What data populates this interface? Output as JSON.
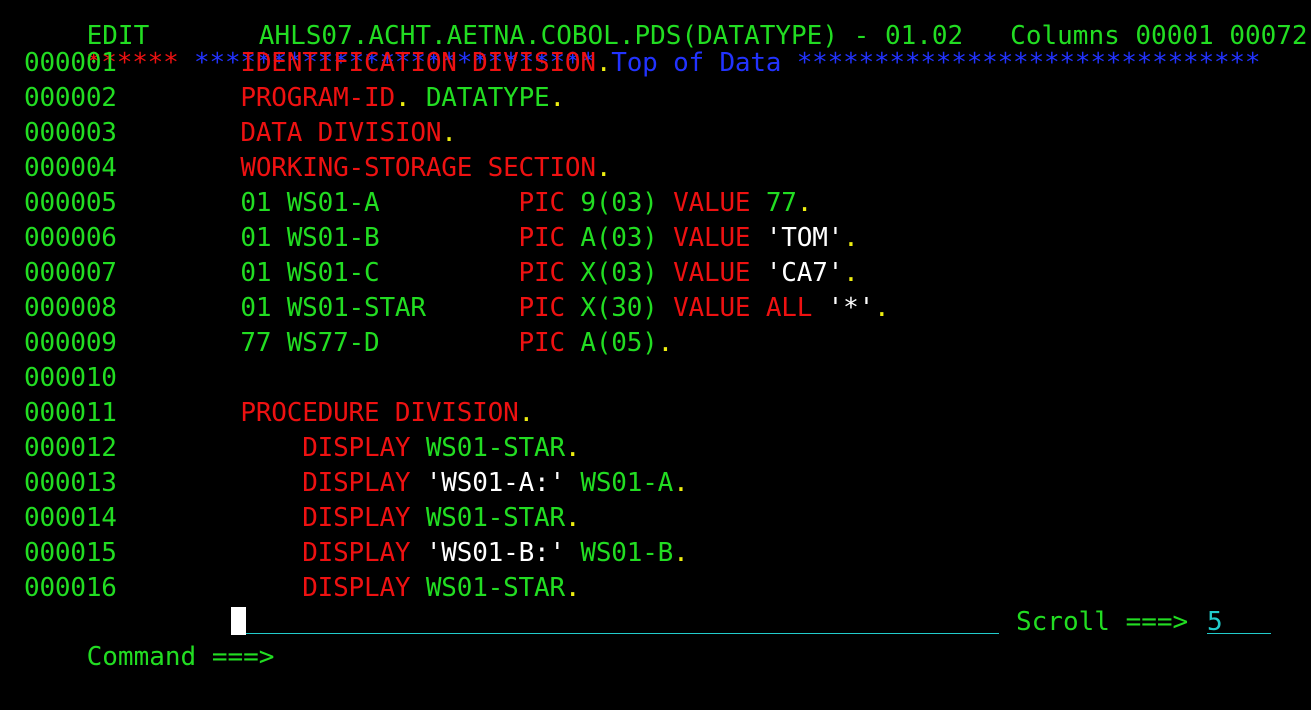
{
  "header": {
    "partial_line": "EDIT       AHLS07.ACHT.AETNA.COBOL.PDS(DATATYPE) - 01.02   Columns 00001 00072"
  },
  "top_of_data": {
    "left_stars": "******",
    "marker": "************************** Top of Data ******************************"
  },
  "lines": [
    {
      "num": "000001",
      "segs": [
        {
          "text": "        ",
          "c": "g"
        },
        {
          "text": "IDENTIFICATION DIVISION",
          "c": "r"
        },
        {
          "text": ".",
          "c": "y"
        }
      ]
    },
    {
      "num": "000002",
      "segs": [
        {
          "text": "        ",
          "c": "g"
        },
        {
          "text": "PROGRAM-ID",
          "c": "r"
        },
        {
          "text": ".",
          "c": "y"
        },
        {
          "text": " DATATYPE",
          "c": "g"
        },
        {
          "text": ".",
          "c": "y"
        }
      ]
    },
    {
      "num": "000003",
      "segs": [
        {
          "text": "        ",
          "c": "g"
        },
        {
          "text": "DATA DIVISION",
          "c": "r"
        },
        {
          "text": ".",
          "c": "y"
        }
      ]
    },
    {
      "num": "000004",
      "segs": [
        {
          "text": "        ",
          "c": "g"
        },
        {
          "text": "WORKING-STORAGE SECTION",
          "c": "r"
        },
        {
          "text": ".",
          "c": "y"
        }
      ]
    },
    {
      "num": "000005",
      "segs": [
        {
          "text": "        01 WS01-A         ",
          "c": "g"
        },
        {
          "text": "PIC",
          "c": "r"
        },
        {
          "text": " 9(03) ",
          "c": "g"
        },
        {
          "text": "VALUE",
          "c": "r"
        },
        {
          "text": " 77",
          "c": "g"
        },
        {
          "text": ".",
          "c": "y"
        }
      ]
    },
    {
      "num": "000006",
      "segs": [
        {
          "text": "        01 WS01-B         ",
          "c": "g"
        },
        {
          "text": "PIC",
          "c": "r"
        },
        {
          "text": " A(03) ",
          "c": "g"
        },
        {
          "text": "VALUE",
          "c": "r"
        },
        {
          "text": " ",
          "c": "g"
        },
        {
          "text": "'TOM'",
          "c": "w"
        },
        {
          "text": ".",
          "c": "y"
        }
      ]
    },
    {
      "num": "000007",
      "segs": [
        {
          "text": "        01 WS01-C         ",
          "c": "g"
        },
        {
          "text": "PIC",
          "c": "r"
        },
        {
          "text": " X(03) ",
          "c": "g"
        },
        {
          "text": "VALUE",
          "c": "r"
        },
        {
          "text": " ",
          "c": "g"
        },
        {
          "text": "'CA7'",
          "c": "w"
        },
        {
          "text": ".",
          "c": "y"
        }
      ]
    },
    {
      "num": "000008",
      "segs": [
        {
          "text": "        01 WS01-STAR      ",
          "c": "g"
        },
        {
          "text": "PIC",
          "c": "r"
        },
        {
          "text": " X(30) ",
          "c": "g"
        },
        {
          "text": "VALUE ALL",
          "c": "r"
        },
        {
          "text": " ",
          "c": "g"
        },
        {
          "text": "'*'",
          "c": "w"
        },
        {
          "text": ".",
          "c": "y"
        }
      ]
    },
    {
      "num": "000009",
      "segs": [
        {
          "text": "        77 WS77-D         ",
          "c": "g"
        },
        {
          "text": "PIC",
          "c": "r"
        },
        {
          "text": " A(05)",
          "c": "g"
        },
        {
          "text": ".",
          "c": "y"
        }
      ]
    },
    {
      "num": "000010",
      "segs": []
    },
    {
      "num": "000011",
      "segs": [
        {
          "text": "        ",
          "c": "g"
        },
        {
          "text": "PROCEDURE DIVISION",
          "c": "r"
        },
        {
          "text": ".",
          "c": "y"
        }
      ]
    },
    {
      "num": "000012",
      "segs": [
        {
          "text": "            ",
          "c": "g"
        },
        {
          "text": "DISPLAY",
          "c": "r"
        },
        {
          "text": " WS01-STAR",
          "c": "g"
        },
        {
          "text": ".",
          "c": "y"
        }
      ]
    },
    {
      "num": "000013",
      "segs": [
        {
          "text": "            ",
          "c": "g"
        },
        {
          "text": "DISPLAY",
          "c": "r"
        },
        {
          "text": " ",
          "c": "g"
        },
        {
          "text": "'WS01-A:'",
          "c": "w"
        },
        {
          "text": " WS01-A",
          "c": "g"
        },
        {
          "text": ".",
          "c": "y"
        }
      ]
    },
    {
      "num": "000014",
      "segs": [
        {
          "text": "            ",
          "c": "g"
        },
        {
          "text": "DISPLAY",
          "c": "r"
        },
        {
          "text": " WS01-STAR",
          "c": "g"
        },
        {
          "text": ".",
          "c": "y"
        }
      ]
    },
    {
      "num": "000015",
      "segs": [
        {
          "text": "            ",
          "c": "g"
        },
        {
          "text": "DISPLAY",
          "c": "r"
        },
        {
          "text": " ",
          "c": "g"
        },
        {
          "text": "'WS01-B:'",
          "c": "w"
        },
        {
          "text": " WS01-B",
          "c": "g"
        },
        {
          "text": ".",
          "c": "y"
        }
      ]
    },
    {
      "num": "000016",
      "segs": [
        {
          "text": "            ",
          "c": "g"
        },
        {
          "text": "DISPLAY",
          "c": "r"
        },
        {
          "text": " WS01-STAR",
          "c": "g"
        },
        {
          "text": ".",
          "c": "y"
        }
      ]
    }
  ],
  "command": {
    "label": "Command ===>",
    "value": ""
  },
  "scroll": {
    "label": "Scroll ===>",
    "value": "5"
  },
  "colors": {
    "background": "#000000",
    "green": "#22dd22",
    "red": "#ee1111",
    "white": "#ffffff",
    "yellow": "#eeee11",
    "blue": "#2233ff",
    "turquoise": "#22cccc"
  }
}
